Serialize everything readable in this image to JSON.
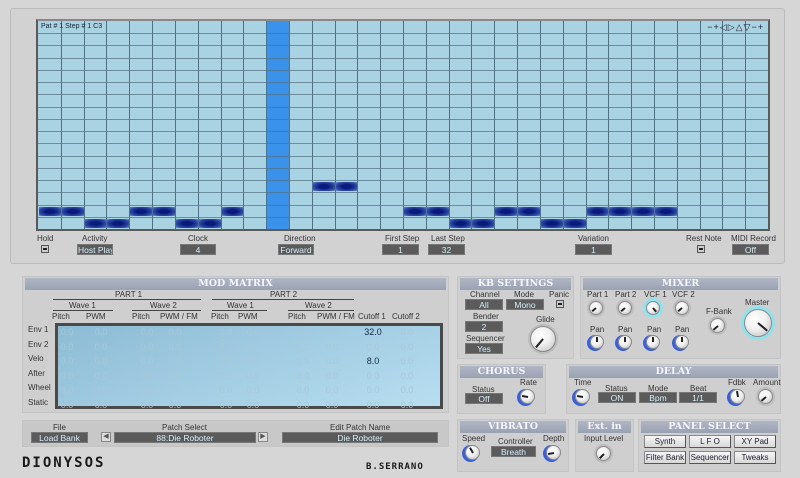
{
  "sequencer": {
    "status": "Pat # 1 Step # 1  C3",
    "view_controls": [
      "−",
      "+",
      "◁",
      "▷",
      "△",
      "▽",
      "−",
      "+"
    ],
    "steps": 32,
    "rows": 17,
    "playhead_step": 11,
    "notes": [
      {
        "step": 1,
        "row": 15
      },
      {
        "step": 2,
        "row": 15
      },
      {
        "step": 3,
        "row": 16
      },
      {
        "step": 4,
        "row": 16
      },
      {
        "step": 5,
        "row": 15
      },
      {
        "step": 6,
        "row": 15
      },
      {
        "step": 7,
        "row": 16
      },
      {
        "step": 8,
        "row": 16
      },
      {
        "step": 9,
        "row": 15
      },
      {
        "step": 13,
        "row": 13
      },
      {
        "step": 14,
        "row": 13
      },
      {
        "step": 17,
        "row": 15
      },
      {
        "step": 18,
        "row": 15
      },
      {
        "step": 19,
        "row": 16
      },
      {
        "step": 20,
        "row": 16
      },
      {
        "step": 21,
        "row": 15
      },
      {
        "step": 22,
        "row": 15
      },
      {
        "step": 23,
        "row": 16
      },
      {
        "step": 24,
        "row": 16
      },
      {
        "step": 25,
        "row": 15
      },
      {
        "step": 26,
        "row": 15
      },
      {
        "step": 27,
        "row": 15
      },
      {
        "step": 28,
        "row": 15
      }
    ],
    "hold_label": "Hold",
    "activity_label": "Activity",
    "activity": "Host Play",
    "clock_label": "Clock",
    "clock": "4",
    "direction_label": "Direction",
    "direction": "Forward",
    "first_step_label": "First Step",
    "first_step": "1",
    "last_step_label": "Last Step",
    "last_step": "32",
    "variation_label": "Variation",
    "variation": "1",
    "rest_note_label": "Rest Note",
    "midi_record_label": "MIDI Record",
    "midi_record": "Off"
  },
  "mod_matrix": {
    "title": "MOD MATRIX",
    "part1": "PART 1",
    "part2": "PART 2",
    "wave1": "Wave 1",
    "wave2": "Wave 2",
    "columns": [
      "Pitch",
      "PWM",
      "Pitch",
      "PWM / FM",
      "Pitch",
      "PWM",
      "Pitch",
      "PWM / FM",
      "Cutoff 1",
      "Cutoff 2"
    ],
    "rows": [
      {
        "label": "Env 1",
        "values": [
          "0.0",
          "0.0",
          "0.0",
          "0.0",
          "0.0",
          "0.0",
          "0.0",
          "0.0",
          "32.0",
          "0.0"
        ]
      },
      {
        "label": "Env 2",
        "values": [
          "0.0",
          "0.0",
          "0.0",
          "0.0",
          "0.0",
          "0.0",
          "0.0",
          "0.0",
          "0.0",
          "0.0"
        ]
      },
      {
        "label": "Velo",
        "values": [
          "0.0",
          "0.0",
          "0.0",
          "0.0",
          "0.0",
          "0.0",
          "0.0",
          "0.0",
          "8.0",
          "0.0"
        ]
      },
      {
        "label": "After",
        "values": [
          "0.0",
          "0.0",
          "0.0",
          "0.0",
          "0.0",
          "0.0",
          "0.0",
          "0.0",
          "0.0",
          "0.0"
        ]
      },
      {
        "label": "Wheel",
        "values": [
          "0.0",
          "0.0",
          "0.0",
          "0.0",
          "0.0",
          "0.0",
          "0.0",
          "0.0",
          "0.0",
          "0.0"
        ]
      },
      {
        "label": "Static",
        "values": [
          "0.0",
          "0.0",
          "0.0",
          "0.0",
          "0.0",
          "0.0",
          "0.0",
          "0.0",
          "0.0",
          "0.0"
        ]
      }
    ]
  },
  "kb": {
    "title": "KB SETTINGS",
    "channel_label": "Channel",
    "channel": "All",
    "mode_label": "Mode",
    "mode": "Mono",
    "panic_label": "Panic",
    "bender_label": "Bender",
    "bender": "2",
    "glide_label": "Glide",
    "sequencer_label": "Sequencer",
    "sequencer": "Yes"
  },
  "mixer": {
    "title": "MIXER",
    "part1": "Part 1",
    "part2": "Part 2",
    "vcf1": "VCF 1",
    "vcf2": "VCF 2",
    "pan": "Pan",
    "fbank": "F-Bank",
    "master": "Master"
  },
  "chorus": {
    "title": "CHORUS",
    "status_label": "Status",
    "status": "Off",
    "rate_label": "Rate"
  },
  "delay": {
    "title": "DELAY",
    "time_label": "Time",
    "status_label": "Status",
    "status": "ON",
    "mode_label": "Mode",
    "mode": "Bpm",
    "beat_label": "Beat",
    "beat": "1/1",
    "fdbk_label": "Fdbk",
    "amount_label": "Amount"
  },
  "vibrato": {
    "title": "VIBRATO",
    "speed_label": "Speed",
    "controller_label": "Controller",
    "controller": "Breath",
    "depth_label": "Depth"
  },
  "ext_in": {
    "title": "Ext. in",
    "input_level_label": "Input Level"
  },
  "panel_select": {
    "title": "PANEL SELECT",
    "buttons": [
      "Synth",
      "L F O",
      "XY Pad",
      "Filter Bank",
      "Sequencer",
      "Tweaks"
    ]
  },
  "patch": {
    "file_label": "File",
    "file": "Load Bank",
    "select_label": "Patch Select",
    "select": "88:Die Roboter",
    "edit_label": "Edit Patch Name",
    "edit": "Die Roboter"
  },
  "branding": {
    "logo": "DIONYSOS",
    "author": "B.SERRANO"
  },
  "colors": {
    "grid": "#a9d3e3",
    "playhead": "#3a92ea",
    "note": "#0a1a7a",
    "header": "#a4abbb",
    "value_box": "#5b5b5b"
  }
}
